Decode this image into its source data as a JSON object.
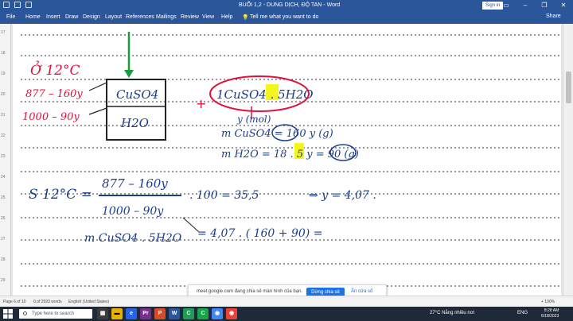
{
  "window": {
    "title": "BUỔI 1,2 - DUNG DỊCH, ĐỘ TAN - Word",
    "signin_label": "Sign in",
    "share_label": "Share"
  },
  "ribbon": {
    "tabs": [
      "File",
      "Home",
      "Insert",
      "Draw",
      "Design",
      "Layout",
      "References",
      "Mailings",
      "Review",
      "View",
      "Help"
    ],
    "tell_me": "Tell me what you want to do"
  },
  "ruler": {
    "numbers": [
      "17",
      "18",
      "19",
      "20",
      "21",
      "22",
      "23",
      "24",
      "25",
      "26",
      "27",
      "28",
      "29"
    ]
  },
  "notes": {
    "left_title": "Ở 12°C",
    "left_line1": "877 – 160y",
    "left_line2": "1000 – 90y",
    "box_top": "CuSO4",
    "box_bottom": "H2O",
    "plus": "+",
    "formula_main": "1CuSO4 . 5H2O",
    "under_formula": "y (mol)",
    "m_cuso4": "m CuSO4 = 160 y (g)",
    "m_h2o": "m H2O = 18 . 5 y = 90 (g)",
    "s_label": "S 12°C =",
    "s_num": "877 – 160y",
    "s_den": "1000 – 90y",
    "s_rest": ". 100 = 35,5",
    "s_arrow": "⇒ y = 4,07 .",
    "m_hydrate": "m CuSO4 . 5H2O",
    "m_hydrate_rhs": "= 4,07 . ( 160 + 90) ="
  },
  "banner": {
    "message": "meet.google.com đang chia sẻ màn hình của bạn.",
    "stop_label": "Dừng chia sẻ",
    "hide_label": "Ẩn cửa sổ"
  },
  "status": {
    "page": "Page 6 of 10",
    "words": "0 of 2593 words",
    "language": "English (United States)",
    "zoom": "+ 100%"
  },
  "taskbar": {
    "search_placeholder": "Type here to search",
    "weather": "27°C  Nắng nhiều nơi",
    "lang": "ENG",
    "time": "8:28 AM",
    "date": "6/18/2023"
  }
}
